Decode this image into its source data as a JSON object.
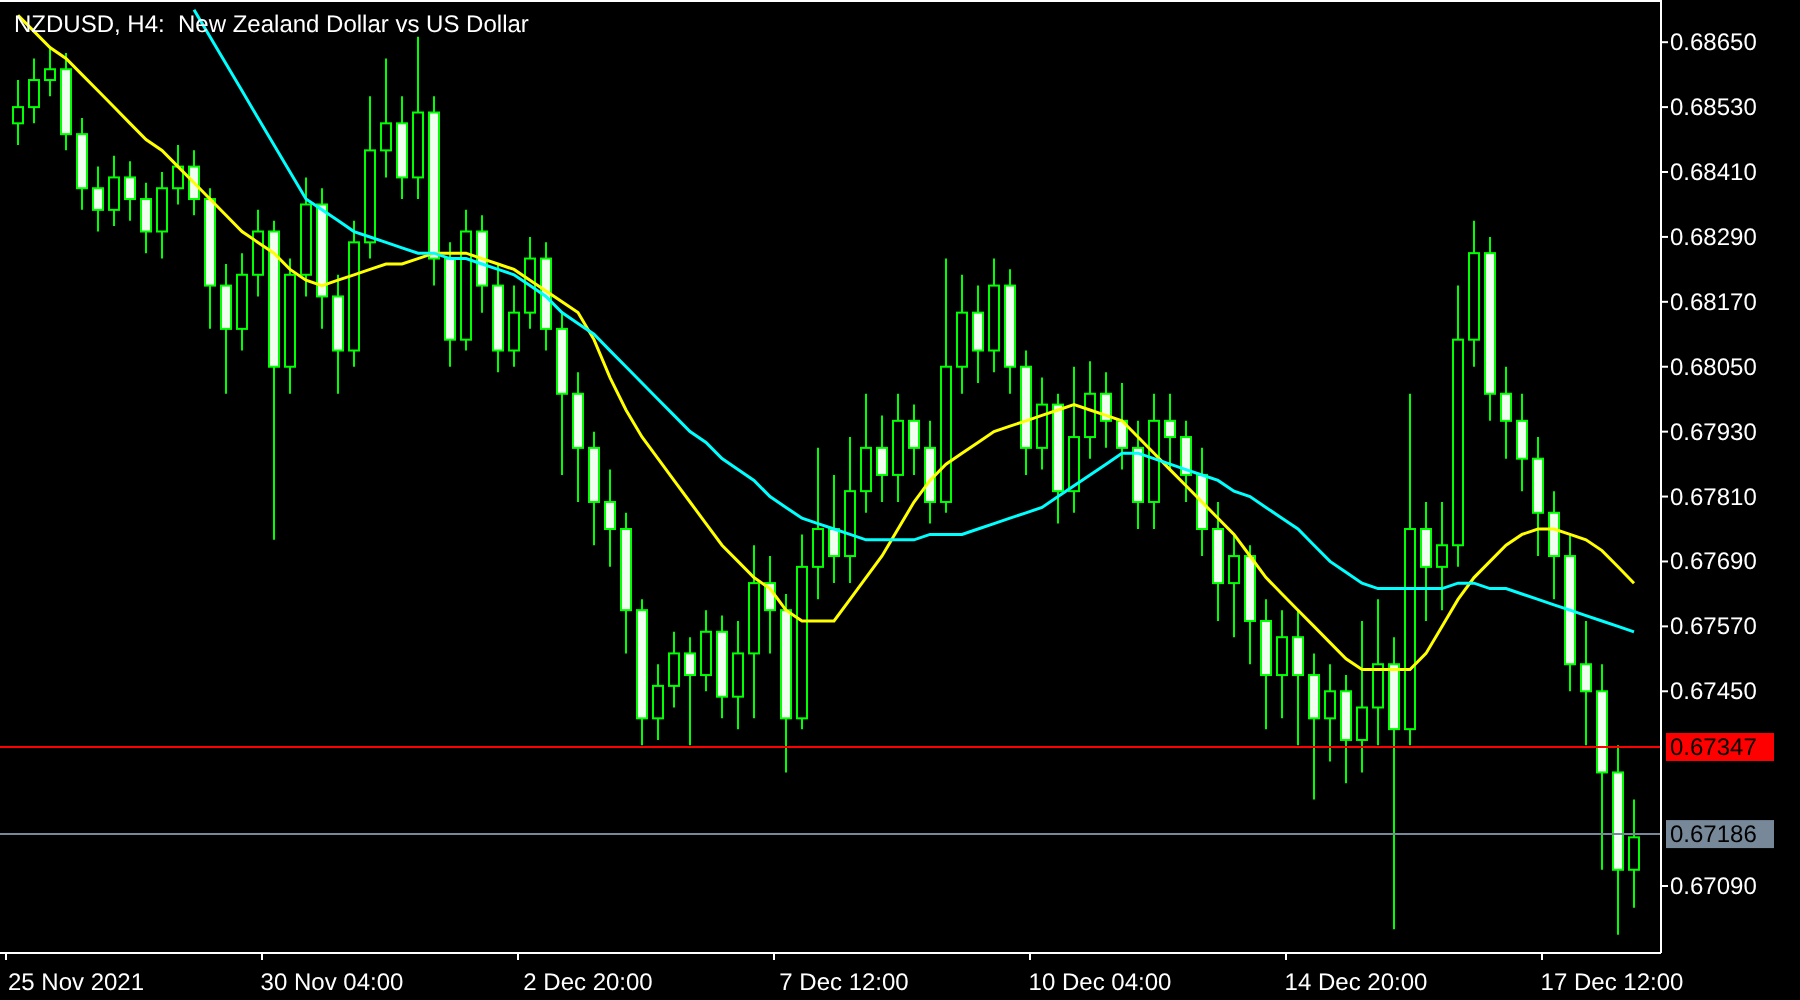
{
  "chart": {
    "title": "NZDUSD, H4:  New Zealand Dollar vs US Dollar",
    "chart_data": {
      "type": "candlestick",
      "ylim": [
        0.66968,
        0.68728
      ],
      "categories": [
        null,
        null,
        null,
        null,
        "25 Nov 2021",
        null,
        null,
        null,
        null,
        null,
        null,
        null,
        null,
        null,
        null,
        null,
        null,
        null,
        null,
        null,
        "30 Nov 04:00",
        null,
        null,
        null,
        null,
        null,
        null,
        null,
        null,
        null,
        null,
        null,
        null,
        null,
        null,
        null,
        "2 Dec 20:00",
        null,
        null,
        null,
        null,
        null,
        null,
        null,
        null,
        null,
        null,
        null,
        null,
        null,
        null,
        null,
        "7 Dec 12:00",
        null,
        null,
        null,
        null,
        null,
        null,
        null,
        null,
        null,
        null,
        null,
        null,
        null,
        null,
        null,
        "10 Dec 04:00",
        null,
        null,
        null,
        null,
        null,
        null,
        null,
        null,
        null,
        null,
        null,
        null,
        null,
        null,
        null,
        "14 Dec 20:00",
        null,
        null,
        null,
        null,
        null,
        null,
        null,
        null,
        null,
        null,
        null,
        null,
        null,
        null,
        null,
        "17 Dec 12:00",
        null
      ],
      "yticks": [
        {
          "value": 0.6865,
          "label": "0.68650"
        },
        {
          "value": 0.6853,
          "label": "0.68530"
        },
        {
          "value": 0.6841,
          "label": "0.68410"
        },
        {
          "value": 0.6829,
          "label": "0.68290"
        },
        {
          "value": 0.6817,
          "label": "0.68170"
        },
        {
          "value": 0.6805,
          "label": "0.68050"
        },
        {
          "value": 0.6793,
          "label": "0.67930"
        },
        {
          "value": 0.6781,
          "label": "0.67810"
        },
        {
          "value": 0.6769,
          "label": "0.67690"
        },
        {
          "value": 0.6757,
          "label": "0.67570"
        },
        {
          "value": 0.6745,
          "label": "0.67450"
        },
        {
          "value": 0.6709,
          "label": "0.67090"
        }
      ],
      "ref_lines": [
        {
          "axis": "y",
          "value": 0.67347,
          "label": "0.67347",
          "color": "#ff0000"
        },
        {
          "axis": "y",
          "value": 0.67186,
          "label": "0.67186",
          "color": "#778899"
        }
      ],
      "ohlc": [
        [
          0.685,
          0.6858,
          0.6846,
          0.6853
        ],
        [
          0.6853,
          0.6862,
          0.685,
          0.6858
        ],
        [
          0.6858,
          0.6864,
          0.6855,
          0.686
        ],
        [
          0.686,
          0.6863,
          0.6845,
          0.6848
        ],
        [
          0.6848,
          0.6851,
          0.6834,
          0.6838
        ],
        [
          0.6838,
          0.6842,
          0.683,
          0.6834
        ],
        [
          0.6834,
          0.6844,
          0.6831,
          0.684
        ],
        [
          0.684,
          0.6843,
          0.6832,
          0.6836
        ],
        [
          0.6836,
          0.6839,
          0.6826,
          0.683
        ],
        [
          0.683,
          0.6841,
          0.6825,
          0.6838
        ],
        [
          0.6838,
          0.6846,
          0.6835,
          0.6842
        ],
        [
          0.6842,
          0.6845,
          0.6833,
          0.6836
        ],
        [
          0.6836,
          0.6838,
          0.6812,
          0.682
        ],
        [
          0.682,
          0.6824,
          0.68,
          0.6812
        ],
        [
          0.6812,
          0.6826,
          0.6808,
          0.6822
        ],
        [
          0.6822,
          0.6834,
          0.6818,
          0.683
        ],
        [
          0.683,
          0.6832,
          0.6773,
          0.6805
        ],
        [
          0.6805,
          0.6825,
          0.68,
          0.6822
        ],
        [
          0.6822,
          0.684,
          0.6818,
          0.6835
        ],
        [
          0.6835,
          0.6838,
          0.6812,
          0.6818
        ],
        [
          0.6818,
          0.6822,
          0.68,
          0.6808
        ],
        [
          0.6808,
          0.6832,
          0.6805,
          0.6828
        ],
        [
          0.6828,
          0.6855,
          0.6825,
          0.6845
        ],
        [
          0.6845,
          0.6862,
          0.684,
          0.685
        ],
        [
          0.685,
          0.6855,
          0.6836,
          0.684
        ],
        [
          0.684,
          0.6866,
          0.6836,
          0.6852
        ],
        [
          0.6852,
          0.6855,
          0.682,
          0.6825
        ],
        [
          0.6825,
          0.6828,
          0.6805,
          0.681
        ],
        [
          0.681,
          0.6834,
          0.6808,
          0.683
        ],
        [
          0.683,
          0.6833,
          0.6815,
          0.682
        ],
        [
          0.682,
          0.6824,
          0.6804,
          0.6808
        ],
        [
          0.6808,
          0.682,
          0.6805,
          0.6815
        ],
        [
          0.6815,
          0.6829,
          0.6812,
          0.6825
        ],
        [
          0.6825,
          0.6828,
          0.6808,
          0.6812
        ],
        [
          0.6812,
          0.6815,
          0.6785,
          0.68
        ],
        [
          0.68,
          0.6804,
          0.678,
          0.679
        ],
        [
          0.679,
          0.6793,
          0.6772,
          0.678
        ],
        [
          0.678,
          0.6786,
          0.6768,
          0.6775
        ],
        [
          0.6775,
          0.6778,
          0.6752,
          0.676
        ],
        [
          0.676,
          0.6762,
          0.6735,
          0.674
        ],
        [
          0.674,
          0.675,
          0.6736,
          0.6746
        ],
        [
          0.6746,
          0.6756,
          0.6742,
          0.6752
        ],
        [
          0.6752,
          0.6755,
          0.6735,
          0.6748
        ],
        [
          0.6748,
          0.676,
          0.6745,
          0.6756
        ],
        [
          0.6756,
          0.6759,
          0.674,
          0.6744
        ],
        [
          0.6744,
          0.6758,
          0.6738,
          0.6752
        ],
        [
          0.6752,
          0.6772,
          0.674,
          0.6765
        ],
        [
          0.6765,
          0.677,
          0.6752,
          0.676
        ],
        [
          0.676,
          0.6763,
          0.673,
          0.674
        ],
        [
          0.674,
          0.6774,
          0.6738,
          0.6768
        ],
        [
          0.6768,
          0.679,
          0.6762,
          0.6775
        ],
        [
          0.6775,
          0.6785,
          0.6765,
          0.677
        ],
        [
          0.677,
          0.6792,
          0.6765,
          0.6782
        ],
        [
          0.6782,
          0.68,
          0.6778,
          0.679
        ],
        [
          0.679,
          0.6796,
          0.678,
          0.6785
        ],
        [
          0.6785,
          0.68,
          0.678,
          0.6795
        ],
        [
          0.6795,
          0.6798,
          0.6785,
          0.679
        ],
        [
          0.679,
          0.6795,
          0.6776,
          0.678
        ],
        [
          0.678,
          0.6825,
          0.6778,
          0.6805
        ],
        [
          0.6805,
          0.6822,
          0.68,
          0.6815
        ],
        [
          0.6815,
          0.682,
          0.6802,
          0.6808
        ],
        [
          0.6808,
          0.6825,
          0.6804,
          0.682
        ],
        [
          0.682,
          0.6823,
          0.68,
          0.6805
        ],
        [
          0.6805,
          0.6808,
          0.6785,
          0.679
        ],
        [
          0.679,
          0.6803,
          0.6786,
          0.6798
        ],
        [
          0.6798,
          0.68,
          0.6776,
          0.6782
        ],
        [
          0.6782,
          0.6805,
          0.6778,
          0.6792
        ],
        [
          0.6792,
          0.6806,
          0.6788,
          0.68
        ],
        [
          0.68,
          0.6804,
          0.679,
          0.6795
        ],
        [
          0.6795,
          0.6802,
          0.6786,
          0.679
        ],
        [
          0.679,
          0.6795,
          0.6775,
          0.678
        ],
        [
          0.678,
          0.68,
          0.6775,
          0.6795
        ],
        [
          0.6795,
          0.68,
          0.6786,
          0.6792
        ],
        [
          0.6792,
          0.6795,
          0.678,
          0.6785
        ],
        [
          0.6785,
          0.679,
          0.677,
          0.6775
        ],
        [
          0.6775,
          0.678,
          0.6758,
          0.6765
        ],
        [
          0.6765,
          0.6774,
          0.6755,
          0.677
        ],
        [
          0.677,
          0.6772,
          0.675,
          0.6758
        ],
        [
          0.6758,
          0.6762,
          0.6738,
          0.6748
        ],
        [
          0.6748,
          0.676,
          0.674,
          0.6755
        ],
        [
          0.6755,
          0.676,
          0.6735,
          0.6748
        ],
        [
          0.6748,
          0.6752,
          0.6725,
          0.674
        ],
        [
          0.674,
          0.675,
          0.6732,
          0.6745
        ],
        [
          0.6745,
          0.6748,
          0.6728,
          0.6736
        ],
        [
          0.6736,
          0.6758,
          0.673,
          0.6742
        ],
        [
          0.6742,
          0.6762,
          0.6735,
          0.675
        ],
        [
          0.675,
          0.6755,
          0.6701,
          0.6738
        ],
        [
          0.6738,
          0.68,
          0.6735,
          0.6775
        ],
        [
          0.6775,
          0.678,
          0.6758,
          0.6768
        ],
        [
          0.6768,
          0.678,
          0.676,
          0.6772
        ],
        [
          0.6772,
          0.682,
          0.6768,
          0.681
        ],
        [
          0.681,
          0.6832,
          0.6805,
          0.6826
        ],
        [
          0.6826,
          0.6829,
          0.6795,
          0.68
        ],
        [
          0.68,
          0.6805,
          0.6788,
          0.6795
        ],
        [
          0.6795,
          0.68,
          0.6782,
          0.6788
        ],
        [
          0.6788,
          0.6792,
          0.677,
          0.6778
        ],
        [
          0.6778,
          0.6782,
          0.6762,
          0.677
        ],
        [
          0.677,
          0.6774,
          0.6745,
          0.675
        ],
        [
          0.675,
          0.6758,
          0.6735,
          0.6745
        ],
        [
          0.6745,
          0.675,
          0.6712,
          0.673
        ],
        [
          0.673,
          0.6735,
          0.67,
          0.6712
        ],
        [
          0.6712,
          0.6725,
          0.6705,
          0.6718
        ]
      ],
      "series": [
        {
          "type": "line",
          "color": "#ffff00",
          "values": [
            0.687,
            0.6867,
            0.6864,
            0.6862,
            0.6859,
            0.6856,
            0.6853,
            0.685,
            0.6847,
            0.6845,
            0.6842,
            0.6839,
            0.6836,
            0.6833,
            0.683,
            0.6828,
            0.6826,
            0.6823,
            0.6821,
            0.682,
            0.6821,
            0.6822,
            0.6823,
            0.6824,
            0.6824,
            0.6825,
            0.6826,
            0.6826,
            0.6826,
            0.6825,
            0.6824,
            0.6823,
            0.6821,
            0.6819,
            0.6817,
            0.6815,
            0.681,
            0.6803,
            0.6797,
            0.6792,
            0.6788,
            0.6784,
            0.678,
            0.6776,
            0.6772,
            0.6769,
            0.6766,
            0.6764,
            0.676,
            0.6758,
            0.6758,
            0.6758,
            0.6762,
            0.6766,
            0.677,
            0.6775,
            0.678,
            0.6784,
            0.6787,
            0.6789,
            0.6791,
            0.6793,
            0.6794,
            0.6795,
            0.6796,
            0.6797,
            0.6798,
            0.6797,
            0.6796,
            0.6795,
            0.6792,
            0.6789,
            0.6786,
            0.6783,
            0.678,
            0.6777,
            0.6774,
            0.677,
            0.6766,
            0.6763,
            0.676,
            0.6757,
            0.6754,
            0.6751,
            0.6749,
            0.6749,
            0.6749,
            0.6749,
            0.6752,
            0.6757,
            0.6762,
            0.6766,
            0.6769,
            0.6772,
            0.6774,
            0.6775,
            0.6775,
            0.6774,
            0.6773,
            0.6771,
            0.6768,
            0.6765
          ]
        },
        {
          "type": "line",
          "color": "#00ffff",
          "values": [
            null,
            null,
            null,
            null,
            null,
            null,
            null,
            null,
            null,
            null,
            null,
            0.6871,
            0.6866,
            0.6861,
            0.6856,
            0.6851,
            0.6846,
            0.6841,
            0.6836,
            0.6834,
            0.6832,
            0.683,
            0.6829,
            0.6828,
            0.6827,
            0.6826,
            0.6826,
            0.6825,
            0.6825,
            0.6824,
            0.6823,
            0.6822,
            0.682,
            0.6818,
            0.6815,
            0.6813,
            0.6811,
            0.6808,
            0.6805,
            0.6802,
            0.6799,
            0.6796,
            0.6793,
            0.6791,
            0.6788,
            0.6786,
            0.6784,
            0.6781,
            0.6779,
            0.6777,
            0.6776,
            0.6775,
            0.6774,
            0.6773,
            0.6773,
            0.6773,
            0.6773,
            0.6774,
            0.6774,
            0.6774,
            0.6775,
            0.6776,
            0.6777,
            0.6778,
            0.6779,
            0.6781,
            0.6783,
            0.6785,
            0.6787,
            0.6789,
            0.6789,
            0.6788,
            0.6787,
            0.6786,
            0.6785,
            0.6784,
            0.6782,
            0.6781,
            0.6779,
            0.6777,
            0.6775,
            0.6772,
            0.6769,
            0.6767,
            0.6765,
            0.6764,
            0.6764,
            0.6764,
            0.6764,
            0.6764,
            0.6765,
            0.6765,
            0.6764,
            0.6764,
            0.6763,
            0.6762,
            0.6761,
            0.676,
            0.6759,
            0.6758,
            0.6757,
            0.6756
          ]
        }
      ]
    }
  }
}
